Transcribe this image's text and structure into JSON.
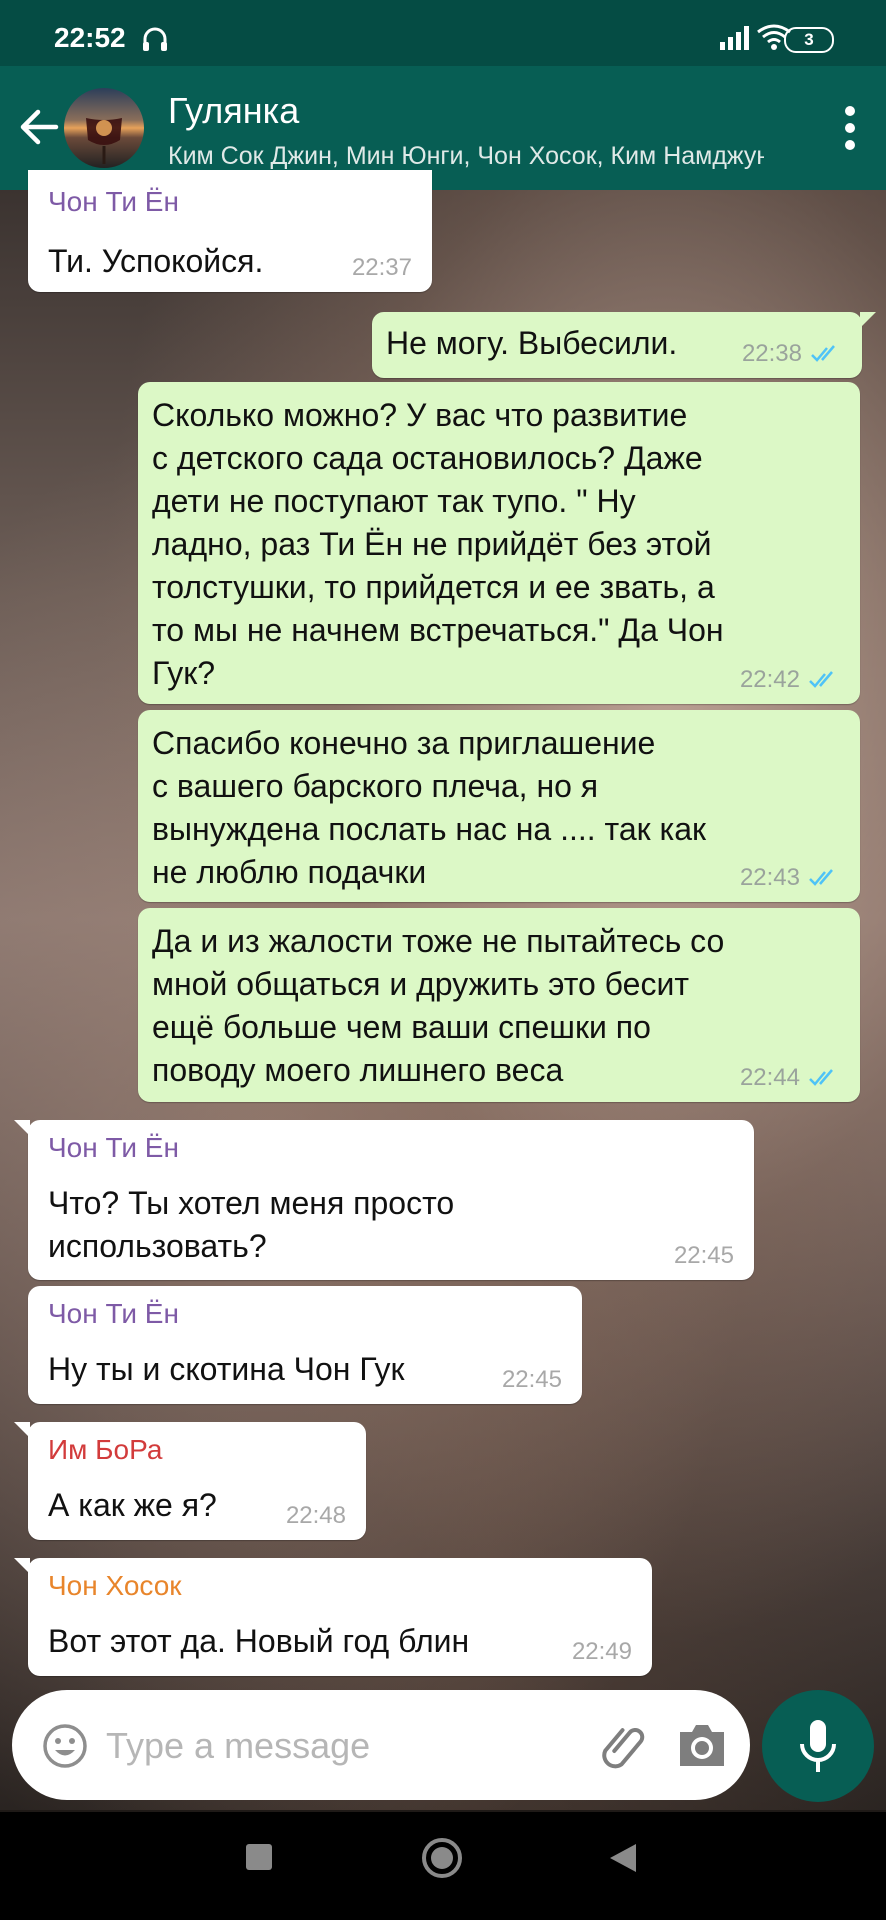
{
  "status_bar": {
    "time": "22:52",
    "battery": "3"
  },
  "header": {
    "title": "Гулянка",
    "subtitle": "Ким Сок Джин, Мин Юнги, Чон Хосок, Ким Намджун"
  },
  "colors": {
    "header": "#075e54",
    "status_bar": "#054c44",
    "outgoing_bubble": "#dcf8c6",
    "incoming_bubble": "#ffffff",
    "tick_read": "#4fc3f7",
    "sender_purple": "#7e5aa6",
    "sender_red": "#d23b3b",
    "sender_orange": "#e8852b"
  },
  "messages": [
    {
      "sender": "Чон Ти Ён",
      "text": "Ти. Успокойся.",
      "time": "22:37"
    },
    {
      "text": "Не могу. Выбесили.",
      "time": "22:38"
    },
    {
      "text": "Сколько можно? У вас что развитие\nс детского сада остановилось? Даже\nдети не поступают так тупо. \" Ну\nладно, раз Ти Ён не прийдёт без этой\nтолстушки, то прийдется и ее звать, а\nто мы не начнем встречаться.\" Да Чон\nГук?",
      "time": "22:42"
    },
    {
      "text": "Спасибо конечно за приглашение\nс вашего барского плеча, но я\nвынуждена послать нас на .... так как\nне люблю подачки",
      "time": "22:43"
    },
    {
      "text": "Да и из жалости тоже не пытайтесь со\nмной общаться и дружить это бесит\nещё больше чем ваши спешки по\nповоду моего лишнего веса",
      "time": "22:44"
    },
    {
      "sender": "Чон Ти Ён",
      "text": "Что? Ты хотел меня просто\nиспользовать?",
      "time": "22:45"
    },
    {
      "sender": "Чон Ти Ён",
      "text": "Ну ты и скотина Чон Гук",
      "time": "22:45"
    },
    {
      "sender": "Им БоРа",
      "text": "А как же я?",
      "time": "22:48"
    },
    {
      "sender": "Чон Хосок",
      "text": "Вот этот да. Новый год блин",
      "time": "22:49"
    }
  ],
  "composer": {
    "placeholder": "Type a message"
  },
  "icons": {
    "status": [
      "headset-icon",
      "signal-icon",
      "wifi-icon",
      "battery-icon"
    ],
    "header": [
      "back-arrow-icon",
      "more-vert-icon"
    ],
    "composer": [
      "emoji-icon",
      "attach-icon",
      "camera-icon",
      "mic-icon"
    ],
    "message": [
      "double-check-icon"
    ],
    "nav": [
      "recents-icon",
      "home-icon",
      "back-icon"
    ]
  }
}
